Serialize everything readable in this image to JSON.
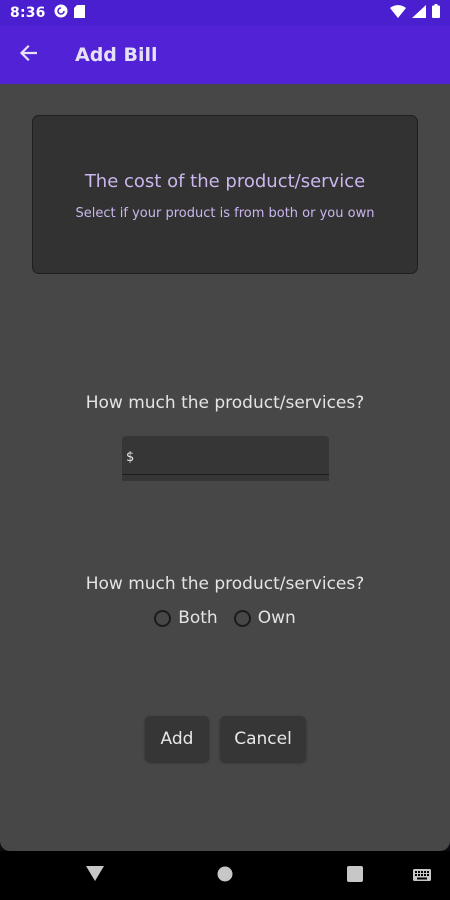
{
  "status_bar": {
    "time": "8:36"
  },
  "app_bar": {
    "title": "Add Bill"
  },
  "info_card": {
    "title": "The cost of the product/service",
    "subtitle": "Select if your product is from both or you own"
  },
  "amount": {
    "question": "How much the product/services?",
    "prefix": "$",
    "value": "",
    "placeholder": ""
  },
  "split": {
    "question": "How much the product/services?",
    "options": [
      "Both",
      "Own"
    ]
  },
  "actions": {
    "add_label": "Add",
    "cancel_label": "Cancel"
  },
  "colors": {
    "status_bar": "#4a1fcf",
    "app_bar": "#5223d6",
    "background": "#474747",
    "card": "#323232",
    "card_text": "#cbb6ee"
  }
}
